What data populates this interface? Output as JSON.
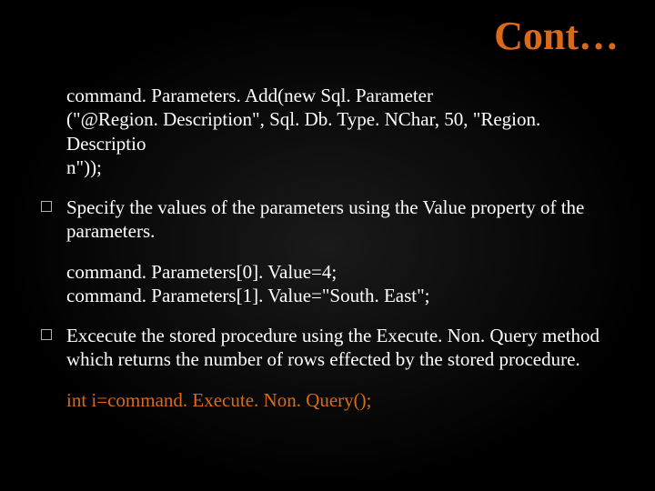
{
  "title": "Cont…",
  "block1": {
    "line1": "command. Parameters. Add(new Sql. Parameter",
    "line2": "(\"@Region. Description\", Sql. Db. Type. NChar, 50, \"Region. Descriptio",
    "line3": "n\"));"
  },
  "bullet1": "Specify the values of the parameters using the Value property of the parameters.",
  "block2": {
    "line1": "command. Parameters[0]. Value=4;",
    "line2": "command. Parameters[1]. Value=\"South. East\";"
  },
  "bullet2": "Excecute the stored procedure using the Execute. Non. Query method which returns the number of rows effected by the stored procedure.",
  "block3": {
    "line1": "int i=command. Execute. Non. Query();"
  }
}
